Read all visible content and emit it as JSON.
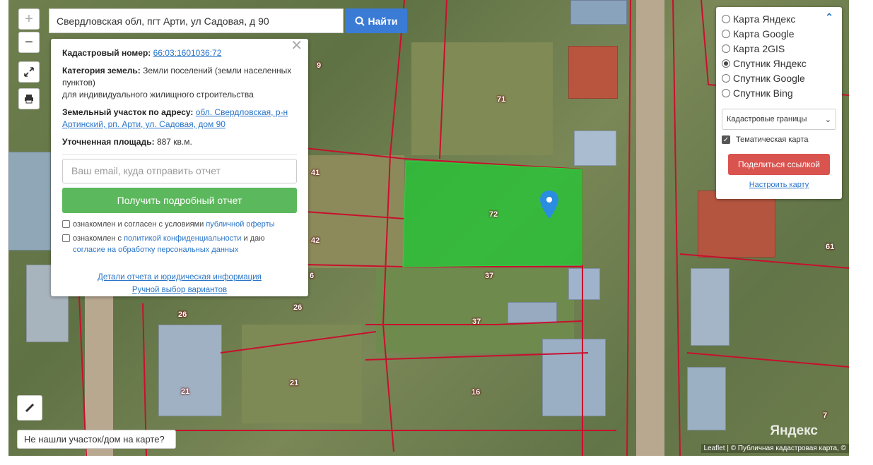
{
  "search": {
    "value": "Свердловская обл, пгт Арти, ул Садовая, д 90",
    "button_label": "Найти"
  },
  "controls": {
    "zoom_in": "+",
    "zoom_out": "−"
  },
  "info": {
    "cadastral_label": "Кадастровый номер:",
    "cadastral_value": "66:03:1601036:72",
    "category_label": "Категория земель:",
    "category_value": "Земли поселений (земли населенных пунктов)",
    "category_use": "для индивидуального жилищного строительства",
    "address_label": "Земельный участок по адресу:",
    "address_value": "обл. Свердловская, р-н Артинский, рп. Арти, ул. Садовая, дом 90",
    "area_label": "Уточненная площадь:",
    "area_value": "887 кв.м.",
    "email_placeholder": "Ваш email, куда отправить отчет",
    "report_button": "Получить подробный отчет",
    "check1_text": "ознакомлен и согласен с условиями",
    "check1_link": "публичной оферты",
    "check2_text_a": "ознакомлен с",
    "check2_link_a": "политикой конфиденциальности",
    "check2_text_b": "и даю",
    "check2_link_b": "согласие на обработку персональных данных",
    "details_link": "Детали отчета и юридическая информация",
    "manual_link": "Ручной выбор вариантов"
  },
  "layers": {
    "options": [
      {
        "label": "Карта Яндекс",
        "checked": false
      },
      {
        "label": "Карта Google",
        "checked": false
      },
      {
        "label": "Карта 2GIS",
        "checked": false
      },
      {
        "label": "Спутник Яндекс",
        "checked": true
      },
      {
        "label": "Спутник Google",
        "checked": false
      },
      {
        "label": "Спутник Bing",
        "checked": false
      }
    ],
    "select_value": "Кадастровые границы",
    "thematic_label": "Тематическая карта",
    "share_button": "Поделиться ссылкой",
    "configure_link": "Настроить карту"
  },
  "map": {
    "plot_numbers": [
      "9",
      "71",
      "41",
      "42",
      "72",
      "37",
      "37",
      "26",
      "26",
      "21",
      "21",
      "16",
      "61",
      "7",
      "6"
    ],
    "highlight_color": "#22c935",
    "boundary_color": "#c8102e"
  },
  "notfound_label": "Не нашли участок/дом на карте?",
  "attribution": {
    "leaflet": "Leaflet",
    "sep": "|",
    "credit": "© Публичная кадастровая карта, ©"
  },
  "yandex_logo": "Яндекс"
}
